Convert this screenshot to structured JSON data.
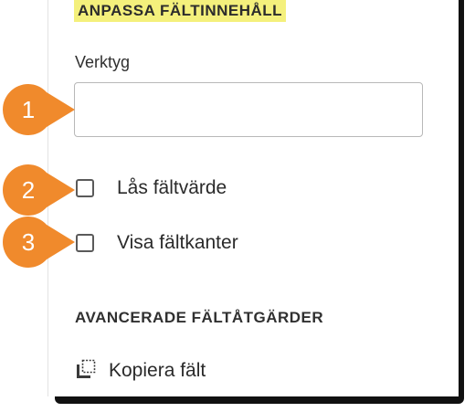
{
  "panel": {
    "customize_title": "ANPASSA FÄLTINNEHÅLL",
    "field_label": "Verktyg",
    "field_value": "",
    "options": [
      {
        "label": "Lås fältvärde",
        "checked": false
      },
      {
        "label": "Visa fältkanter",
        "checked": false
      }
    ],
    "advanced_title": "AVANCERADE FÄLTÅTGÄRDER",
    "copy_action_label": "Kopiera fält",
    "copy_action_icon": "copy-field-icon"
  },
  "callouts": {
    "color": "#f08a2c",
    "items": [
      {
        "number": "1"
      },
      {
        "number": "2"
      },
      {
        "number": "3"
      }
    ]
  }
}
